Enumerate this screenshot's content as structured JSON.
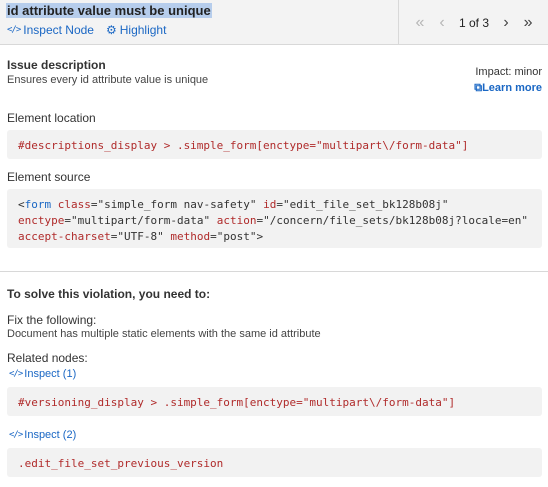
{
  "header": {
    "issue_title": "id attribute value must be unique",
    "inspect_node_label": "Inspect Node",
    "highlight_label": "Highlight"
  },
  "pager": {
    "count": "1 of 3"
  },
  "issue": {
    "heading": "Issue description",
    "text": "Ensures every id attribute value is unique",
    "impact": "Impact: minor",
    "learn_more": "Learn more"
  },
  "element_location": {
    "label": "Element location",
    "selector": "#descriptions_display > .simple_form[enctype=\"multipart\\/form-data\"]"
  },
  "element_source": {
    "label": "Element source",
    "tag_open": "<",
    "tag_name": "form",
    "line1_rest": [
      {
        "t": "attr",
        "v": " class"
      },
      {
        "t": "sym",
        "v": "=\""
      },
      {
        "t": "val",
        "v": "simple_form nav-safety"
      },
      {
        "t": "sym",
        "v": "\" "
      },
      {
        "t": "attr",
        "v": "id"
      },
      {
        "t": "sym",
        "v": "=\""
      },
      {
        "t": "val",
        "v": "edit_file_set_bk128b08j"
      },
      {
        "t": "sym",
        "v": "\""
      }
    ],
    "line2": [
      {
        "t": "attr",
        "v": "enctype"
      },
      {
        "t": "sym",
        "v": "=\""
      },
      {
        "t": "val",
        "v": "multipart/form-data"
      },
      {
        "t": "sym",
        "v": "\" "
      },
      {
        "t": "attr",
        "v": "action"
      },
      {
        "t": "sym",
        "v": "=\""
      },
      {
        "t": "val",
        "v": "/concern/file_sets/bk128b08j?locale=en"
      },
      {
        "t": "sym",
        "v": "\""
      }
    ],
    "line3": [
      {
        "t": "attr",
        "v": "accept-charset"
      },
      {
        "t": "sym",
        "v": "=\""
      },
      {
        "t": "val",
        "v": "UTF-8"
      },
      {
        "t": "sym",
        "v": "\" "
      },
      {
        "t": "attr",
        "v": "method"
      },
      {
        "t": "sym",
        "v": "=\""
      },
      {
        "t": "val",
        "v": "post"
      },
      {
        "t": "sym",
        "v": "\">"
      }
    ]
  },
  "solve": {
    "heading": "To solve this violation, you need to:",
    "fix_heading": "Fix the following:",
    "fix_text": "Document has multiple static elements with the same id attribute",
    "related_heading": "Related nodes:",
    "related": [
      {
        "link": "Inspect (1)",
        "selector": "#versioning_display > .simple_form[enctype=\"multipart\\/form-data\"]"
      },
      {
        "link": "Inspect (2)",
        "selector": ".edit_file_set_previous_version"
      }
    ]
  }
}
